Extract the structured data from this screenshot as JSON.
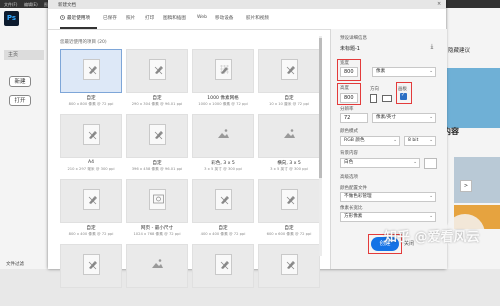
{
  "menubar": {
    "items": [
      "文件(F)",
      "编辑(E)",
      "图像(I)"
    ]
  },
  "home": {
    "logo": "Ps",
    "nav_label": "主页",
    "new_button": "新建",
    "open_button": "打开",
    "bottom_text": "文件过滤",
    "right_title": "隐藏建议",
    "right_heading": "内容",
    "right_arrow": ">"
  },
  "dialog": {
    "title": "新建文档",
    "close_glyph": "×",
    "tabs": [
      "最近使用项",
      "已保存",
      "照片",
      "打印",
      "图稿和插图",
      "Web",
      "移动设备",
      "胶片和视频"
    ],
    "recent_heading": "您最近使用的项目 (20)",
    "tiles": [
      {
        "name": "自定",
        "meta": "800 x 800 像素 @ 72 ppi",
        "selected": true,
        "icon": "doc-icon"
      },
      {
        "name": "自定",
        "meta": "290 x 304 像素 @ 96.01 ppi",
        "selected": false,
        "icon": "doc-icon"
      },
      {
        "name": "1000 像素网格",
        "meta": "1000 x 1000 像素 @ 72 ppi",
        "selected": false,
        "icon": "grid-doc-icon"
      },
      {
        "name": "自定",
        "meta": "10 x 10 厘米 @ 72 ppi",
        "selected": false,
        "icon": "doc-icon"
      },
      {
        "name": "A4",
        "meta": "210 x 297 毫米 @ 300 ppi",
        "selected": false,
        "icon": "doc-icon"
      },
      {
        "name": "自定",
        "meta": "396 x 458 像素 @ 96.01 ppi",
        "selected": false,
        "icon": "doc-icon"
      },
      {
        "name": "彩色, 3 x 5",
        "meta": "3 x 5 英寸 @ 300 ppi",
        "selected": false,
        "icon": "image-icon"
      },
      {
        "name": "横向, 3 x 5",
        "meta": "3 x 5 英寸 @ 300 ppi",
        "selected": false,
        "icon": "image-icon"
      },
      {
        "name": "自定",
        "meta": "800 x 400 像素 @ 72 ppi",
        "selected": false,
        "icon": "doc-icon"
      },
      {
        "name": "网页 - 最小尺寸",
        "meta": "1024 x 768 像素 @ 72 ppi",
        "selected": false,
        "icon": "web-icon"
      },
      {
        "name": "自定",
        "meta": "400 x 400 像素 @ 72 ppi",
        "selected": false,
        "icon": "doc-icon"
      },
      {
        "name": "自定",
        "meta": "600 x 600 像素 @ 72 ppi",
        "selected": false,
        "icon": "doc-icon"
      },
      {
        "name": "",
        "meta": "",
        "selected": false,
        "icon": "doc-icon"
      },
      {
        "name": "",
        "meta": "",
        "selected": false,
        "icon": "image-icon"
      },
      {
        "name": "",
        "meta": "",
        "selected": false,
        "icon": "doc-icon"
      },
      {
        "name": "",
        "meta": "",
        "selected": false,
        "icon": "doc-icon"
      }
    ]
  },
  "panel": {
    "section_title": "预设详细信息",
    "doc_name": "未标题-1",
    "save_icon_glyph": "⤓",
    "width_label": "宽度",
    "width_value": "800",
    "width_unit": "像素",
    "height_label": "高度",
    "height_value": "800",
    "orientation_label": "方向",
    "artboard_label": "画板",
    "artboard_checked": true,
    "resolution_label": "分辨率",
    "resolution_value": "72",
    "resolution_unit": "像素/英寸",
    "colormode_label": "颜色模式",
    "colormode_value": "RGB 颜色",
    "bitdepth_value": "8 bit",
    "bg_label": "背景内容",
    "bg_value": "白色",
    "advanced_label": "高级选项",
    "profile_label": "颜色配置文件",
    "profile_value": "不做色彩管理",
    "pixel_aspect_label": "像素长宽比",
    "pixel_aspect_value": "方形像素",
    "create_button": "创建",
    "close_button": "关闭"
  },
  "watermark": "知乎 @爱看风云",
  "colors": {
    "accent": "#1473e6",
    "highlight_box": "#e33b3b",
    "ps_blue": "#31a8ff"
  }
}
